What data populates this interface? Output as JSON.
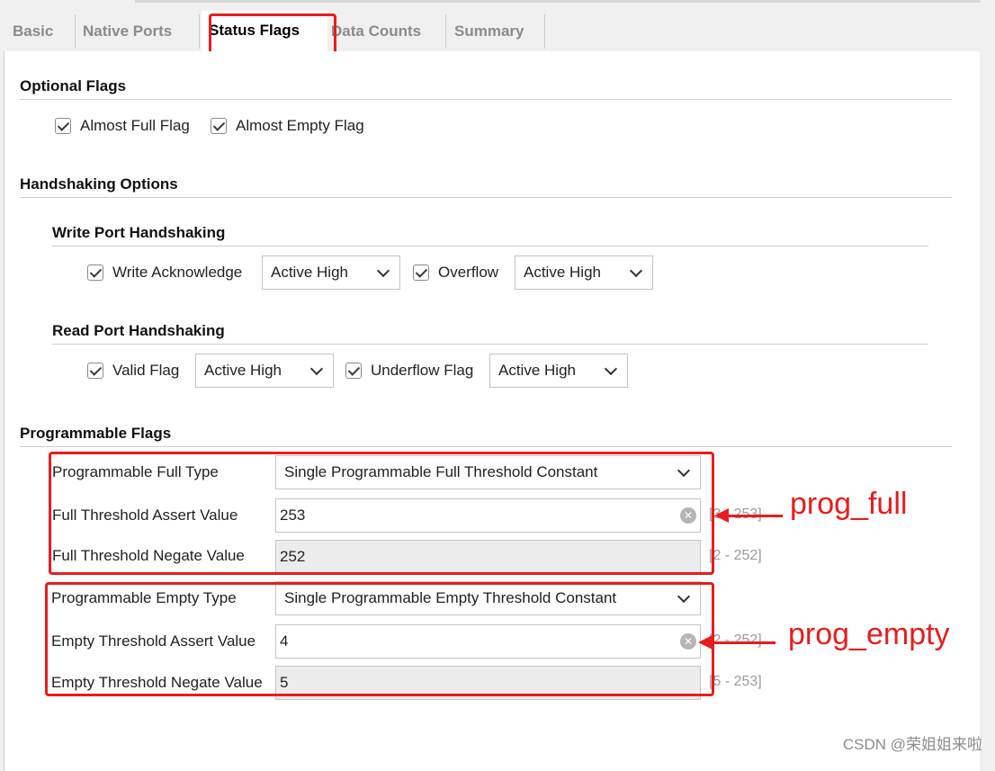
{
  "tabs": [
    {
      "label": "Basic"
    },
    {
      "label": "Native Ports"
    },
    {
      "label": "Status Flags"
    },
    {
      "label": "Data Counts"
    },
    {
      "label": "Summary"
    }
  ],
  "active_tab": "Status Flags",
  "optional_flags": {
    "title": "Optional Flags",
    "almost_full": {
      "label": "Almost Full Flag",
      "checked": true
    },
    "almost_empty": {
      "label": "Almost Empty Flag",
      "checked": true
    }
  },
  "handshaking": {
    "title": "Handshaking Options",
    "write_port": {
      "title": "Write Port Handshaking",
      "write_ack": {
        "label": "Write Acknowledge",
        "checked": true,
        "polarity": "Active High"
      },
      "overflow": {
        "label": "Overflow",
        "checked": true,
        "polarity": "Active High"
      }
    },
    "read_port": {
      "title": "Read Port Handshaking",
      "valid": {
        "label": "Valid Flag",
        "checked": true,
        "polarity": "Active High"
      },
      "underflow": {
        "label": "Underflow Flag",
        "checked": true,
        "polarity": "Active High"
      }
    }
  },
  "programmable_flags": {
    "title": "Programmable Flags",
    "full_type": {
      "label": "Programmable Full Type",
      "value": "Single Programmable Full Threshold Constant"
    },
    "full_assert": {
      "label": "Full Threshold Assert Value",
      "value": "253",
      "range": "[3 - 253]"
    },
    "full_negate": {
      "label": "Full Threshold Negate Value",
      "value": "252",
      "range": "[2 - 252]"
    },
    "empty_type": {
      "label": "Programmable Empty Type",
      "value": "Single Programmable Empty Threshold Constant"
    },
    "empty_assert": {
      "label": "Empty Threshold Assert Value",
      "value": "4",
      "range": "[2 - 252]"
    },
    "empty_negate": {
      "label": "Empty Threshold Negate Value",
      "value": "5",
      "range": "[5 - 253]"
    }
  },
  "annotations": {
    "prog_full": "prog_full",
    "prog_empty": "prog_empty"
  },
  "watermark": "CSDN @荣姐姐来啦",
  "colors": {
    "annotation_red": "#ea1c1c",
    "panel_bg": "#ffffff",
    "readonly_bg": "#ececec",
    "inactive_tab": "#8a8a8a"
  }
}
